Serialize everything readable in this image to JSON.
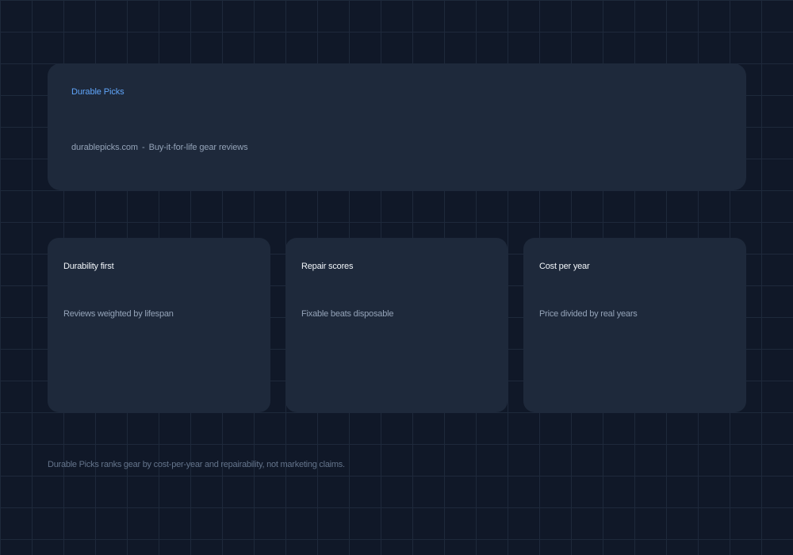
{
  "hero": {
    "brand": "Durable Picks",
    "domain": "durablepicks.com",
    "separator": "-",
    "tagline": "Buy-it-for-life gear reviews"
  },
  "cards": [
    {
      "title": "Durability first",
      "body": "Reviews weighted by lifespan"
    },
    {
      "title": "Repair scores",
      "body": "Fixable beats disposable"
    },
    {
      "title": "Cost per year",
      "body": "Price divided by real years"
    }
  ],
  "footer": {
    "note": "Durable Picks ranks gear by cost-per-year and repairability, not marketing claims."
  },
  "colors": {
    "background": "#101828",
    "grid_line": "#1e293b",
    "panel": "#1e293b",
    "accent": "#60a5fa",
    "title_text": "#f1f5f9",
    "muted_text": "#94a3b8",
    "footer_text": "#64748b"
  }
}
